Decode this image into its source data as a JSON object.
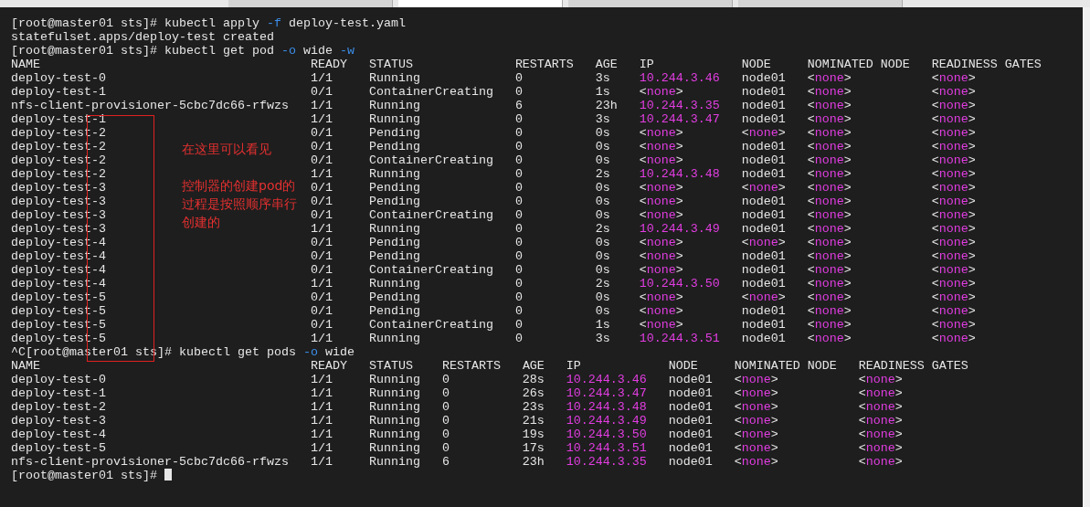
{
  "terminal": {
    "blocks": [
      {
        "kind": "command",
        "parts": [
          {
            "text": "[root@master01 sts]# kubectl apply "
          },
          {
            "text": "-f",
            "kind": "flag"
          },
          {
            "text": " deploy-test.yaml"
          }
        ]
      },
      {
        "kind": "output",
        "text": "statefulset.apps/deploy-test created"
      },
      {
        "kind": "command",
        "parts": [
          {
            "text": "[root@master01 sts]# kubectl get pod "
          },
          {
            "text": "-o",
            "kind": "flag"
          },
          {
            "text": " wide "
          },
          {
            "text": "-w",
            "kind": "flag"
          }
        ]
      },
      {
        "kind": "table",
        "columns": [
          "NAME",
          "READY",
          "STATUS",
          "RESTARTS",
          "AGE",
          "IP",
          "NODE",
          "NOMINATED NODE",
          "READINESS GATES"
        ],
        "rows": [
          [
            "deploy-test-0",
            "1/1",
            "Running",
            "0",
            "3s",
            {
              "kind": "highlight",
              "text": "10.244.3.46"
            },
            "node01",
            {
              "kind": "placeholder",
              "parts": [
                "<",
                "none",
                ">"
              ]
            },
            {
              "kind": "placeholder",
              "parts": [
                "<",
                "none",
                ">"
              ]
            }
          ],
          [
            "deploy-test-1",
            "0/1",
            "ContainerCreating",
            "0",
            "1s",
            {
              "kind": "placeholder",
              "parts": [
                "<",
                "none",
                ">"
              ]
            },
            "node01",
            {
              "kind": "placeholder",
              "parts": [
                "<",
                "none",
                ">"
              ]
            },
            {
              "kind": "placeholder",
              "parts": [
                "<",
                "none",
                ">"
              ]
            }
          ],
          [
            "nfs-client-provisioner-5cbc7dc66-rfwzs",
            "1/1",
            "Running",
            "6",
            "23h",
            {
              "kind": "highlight",
              "text": "10.244.3.35"
            },
            "node01",
            {
              "kind": "placeholder",
              "parts": [
                "<",
                "none",
                ">"
              ]
            },
            {
              "kind": "placeholder",
              "parts": [
                "<",
                "none",
                ">"
              ]
            }
          ],
          [
            "deploy-test-1",
            "1/1",
            "Running",
            "0",
            "3s",
            {
              "kind": "highlight",
              "text": "10.244.3.47"
            },
            "node01",
            {
              "kind": "placeholder",
              "parts": [
                "<",
                "none",
                ">"
              ]
            },
            {
              "kind": "placeholder",
              "parts": [
                "<",
                "none",
                ">"
              ]
            }
          ],
          [
            "deploy-test-2",
            "0/1",
            "Pending",
            "0",
            "0s",
            {
              "kind": "placeholder",
              "parts": [
                "<",
                "none",
                ">"
              ]
            },
            {
              "kind": "placeholder",
              "parts": [
                "<",
                "none",
                ">"
              ]
            },
            {
              "kind": "placeholder",
              "parts": [
                "<",
                "none",
                ">"
              ]
            },
            {
              "kind": "placeholder",
              "parts": [
                "<",
                "none",
                ">"
              ]
            }
          ],
          [
            "deploy-test-2",
            "0/1",
            "Pending",
            "0",
            "0s",
            {
              "kind": "placeholder",
              "parts": [
                "<",
                "none",
                ">"
              ]
            },
            "node01",
            {
              "kind": "placeholder",
              "parts": [
                "<",
                "none",
                ">"
              ]
            },
            {
              "kind": "placeholder",
              "parts": [
                "<",
                "none",
                ">"
              ]
            }
          ],
          [
            "deploy-test-2",
            "0/1",
            "ContainerCreating",
            "0",
            "0s",
            {
              "kind": "placeholder",
              "parts": [
                "<",
                "none",
                ">"
              ]
            },
            "node01",
            {
              "kind": "placeholder",
              "parts": [
                "<",
                "none",
                ">"
              ]
            },
            {
              "kind": "placeholder",
              "parts": [
                "<",
                "none",
                ">"
              ]
            }
          ],
          [
            "deploy-test-2",
            "1/1",
            "Running",
            "0",
            "2s",
            {
              "kind": "highlight",
              "text": "10.244.3.48"
            },
            "node01",
            {
              "kind": "placeholder",
              "parts": [
                "<",
                "none",
                ">"
              ]
            },
            {
              "kind": "placeholder",
              "parts": [
                "<",
                "none",
                ">"
              ]
            }
          ],
          [
            "deploy-test-3",
            "0/1",
            "Pending",
            "0",
            "0s",
            {
              "kind": "placeholder",
              "parts": [
                "<",
                "none",
                ">"
              ]
            },
            {
              "kind": "placeholder",
              "parts": [
                "<",
                "none",
                ">"
              ]
            },
            {
              "kind": "placeholder",
              "parts": [
                "<",
                "none",
                ">"
              ]
            },
            {
              "kind": "placeholder",
              "parts": [
                "<",
                "none",
                ">"
              ]
            }
          ],
          [
            "deploy-test-3",
            "0/1",
            "Pending",
            "0",
            "0s",
            {
              "kind": "placeholder",
              "parts": [
                "<",
                "none",
                ">"
              ]
            },
            "node01",
            {
              "kind": "placeholder",
              "parts": [
                "<",
                "none",
                ">"
              ]
            },
            {
              "kind": "placeholder",
              "parts": [
                "<",
                "none",
                ">"
              ]
            }
          ],
          [
            "deploy-test-3",
            "0/1",
            "ContainerCreating",
            "0",
            "0s",
            {
              "kind": "placeholder",
              "parts": [
                "<",
                "none",
                ">"
              ]
            },
            "node01",
            {
              "kind": "placeholder",
              "parts": [
                "<",
                "none",
                ">"
              ]
            },
            {
              "kind": "placeholder",
              "parts": [
                "<",
                "none",
                ">"
              ]
            }
          ],
          [
            "deploy-test-3",
            "1/1",
            "Running",
            "0",
            "2s",
            {
              "kind": "highlight",
              "text": "10.244.3.49"
            },
            "node01",
            {
              "kind": "placeholder",
              "parts": [
                "<",
                "none",
                ">"
              ]
            },
            {
              "kind": "placeholder",
              "parts": [
                "<",
                "none",
                ">"
              ]
            }
          ],
          [
            "deploy-test-4",
            "0/1",
            "Pending",
            "0",
            "0s",
            {
              "kind": "placeholder",
              "parts": [
                "<",
                "none",
                ">"
              ]
            },
            {
              "kind": "placeholder",
              "parts": [
                "<",
                "none",
                ">"
              ]
            },
            {
              "kind": "placeholder",
              "parts": [
                "<",
                "none",
                ">"
              ]
            },
            {
              "kind": "placeholder",
              "parts": [
                "<",
                "none",
                ">"
              ]
            }
          ],
          [
            "deploy-test-4",
            "0/1",
            "Pending",
            "0",
            "0s",
            {
              "kind": "placeholder",
              "parts": [
                "<",
                "none",
                ">"
              ]
            },
            "node01",
            {
              "kind": "placeholder",
              "parts": [
                "<",
                "none",
                ">"
              ]
            },
            {
              "kind": "placeholder",
              "parts": [
                "<",
                "none",
                ">"
              ]
            }
          ],
          [
            "deploy-test-4",
            "0/1",
            "ContainerCreating",
            "0",
            "0s",
            {
              "kind": "placeholder",
              "parts": [
                "<",
                "none",
                ">"
              ]
            },
            "node01",
            {
              "kind": "placeholder",
              "parts": [
                "<",
                "none",
                ">"
              ]
            },
            {
              "kind": "placeholder",
              "parts": [
                "<",
                "none",
                ">"
              ]
            }
          ],
          [
            "deploy-test-4",
            "1/1",
            "Running",
            "0",
            "2s",
            {
              "kind": "highlight",
              "text": "10.244.3.50"
            },
            "node01",
            {
              "kind": "placeholder",
              "parts": [
                "<",
                "none",
                ">"
              ]
            },
            {
              "kind": "placeholder",
              "parts": [
                "<",
                "none",
                ">"
              ]
            }
          ],
          [
            "deploy-test-5",
            "0/1",
            "Pending",
            "0",
            "0s",
            {
              "kind": "placeholder",
              "parts": [
                "<",
                "none",
                ">"
              ]
            },
            {
              "kind": "placeholder",
              "parts": [
                "<",
                "none",
                ">"
              ]
            },
            {
              "kind": "placeholder",
              "parts": [
                "<",
                "none",
                ">"
              ]
            },
            {
              "kind": "placeholder",
              "parts": [
                "<",
                "none",
                ">"
              ]
            }
          ],
          [
            "deploy-test-5",
            "0/1",
            "Pending",
            "0",
            "0s",
            {
              "kind": "placeholder",
              "parts": [
                "<",
                "none",
                ">"
              ]
            },
            "node01",
            {
              "kind": "placeholder",
              "parts": [
                "<",
                "none",
                ">"
              ]
            },
            {
              "kind": "placeholder",
              "parts": [
                "<",
                "none",
                ">"
              ]
            }
          ],
          [
            "deploy-test-5",
            "0/1",
            "ContainerCreating",
            "0",
            "1s",
            {
              "kind": "placeholder",
              "parts": [
                "<",
                "none",
                ">"
              ]
            },
            "node01",
            {
              "kind": "placeholder",
              "parts": [
                "<",
                "none",
                ">"
              ]
            },
            {
              "kind": "placeholder",
              "parts": [
                "<",
                "none",
                ">"
              ]
            }
          ],
          [
            "deploy-test-5",
            "1/1",
            "Running",
            "0",
            "3s",
            {
              "kind": "highlight",
              "text": "10.244.3.51"
            },
            "node01",
            {
              "kind": "placeholder",
              "parts": [
                "<",
                "none",
                ">"
              ]
            },
            {
              "kind": "placeholder",
              "parts": [
                "<",
                "none",
                ">"
              ]
            }
          ]
        ]
      },
      {
        "kind": "command",
        "parts": [
          {
            "text": "^C[root@master01 sts]# kubectl get pods "
          },
          {
            "text": "-o",
            "kind": "flag"
          },
          {
            "text": " wide"
          }
        ]
      },
      {
        "kind": "table",
        "columns": [
          "NAME",
          "READY",
          "STATUS",
          "RESTARTS",
          "AGE",
          "IP",
          "NODE",
          "NOMINATED NODE",
          "READINESS GATES"
        ],
        "rows": [
          [
            "deploy-test-0",
            "1/1",
            "Running",
            "0",
            "28s",
            {
              "kind": "highlight",
              "text": "10.244.3.46"
            },
            "node01",
            {
              "kind": "placeholder",
              "parts": [
                "<",
                "none",
                ">"
              ]
            },
            {
              "kind": "placeholder",
              "parts": [
                "<",
                "none",
                ">"
              ]
            }
          ],
          [
            "deploy-test-1",
            "1/1",
            "Running",
            "0",
            "26s",
            {
              "kind": "highlight",
              "text": "10.244.3.47"
            },
            "node01",
            {
              "kind": "placeholder",
              "parts": [
                "<",
                "none",
                ">"
              ]
            },
            {
              "kind": "placeholder",
              "parts": [
                "<",
                "none",
                ">"
              ]
            }
          ],
          [
            "deploy-test-2",
            "1/1",
            "Running",
            "0",
            "23s",
            {
              "kind": "highlight",
              "text": "10.244.3.48"
            },
            "node01",
            {
              "kind": "placeholder",
              "parts": [
                "<",
                "none",
                ">"
              ]
            },
            {
              "kind": "placeholder",
              "parts": [
                "<",
                "none",
                ">"
              ]
            }
          ],
          [
            "deploy-test-3",
            "1/1",
            "Running",
            "0",
            "21s",
            {
              "kind": "highlight",
              "text": "10.244.3.49"
            },
            "node01",
            {
              "kind": "placeholder",
              "parts": [
                "<",
                "none",
                ">"
              ]
            },
            {
              "kind": "placeholder",
              "parts": [
                "<",
                "none",
                ">"
              ]
            }
          ],
          [
            "deploy-test-4",
            "1/1",
            "Running",
            "0",
            "19s",
            {
              "kind": "highlight",
              "text": "10.244.3.50"
            },
            "node01",
            {
              "kind": "placeholder",
              "parts": [
                "<",
                "none",
                ">"
              ]
            },
            {
              "kind": "placeholder",
              "parts": [
                "<",
                "none",
                ">"
              ]
            }
          ],
          [
            "deploy-test-5",
            "1/1",
            "Running",
            "0",
            "17s",
            {
              "kind": "highlight",
              "text": "10.244.3.51"
            },
            "node01",
            {
              "kind": "placeholder",
              "parts": [
                "<",
                "none",
                ">"
              ]
            },
            {
              "kind": "placeholder",
              "parts": [
                "<",
                "none",
                ">"
              ]
            }
          ],
          [
            "nfs-client-provisioner-5cbc7dc66-rfwzs",
            "1/1",
            "Running",
            "6",
            "23h",
            {
              "kind": "highlight",
              "text": "10.244.3.35"
            },
            "node01",
            {
              "kind": "placeholder",
              "parts": [
                "<",
                "none",
                ">"
              ]
            },
            {
              "kind": "placeholder",
              "parts": [
                "<",
                "none",
                ">"
              ]
            }
          ]
        ]
      },
      {
        "kind": "command",
        "cursor": true,
        "parts": [
          {
            "text": "[root@master01 sts]# "
          }
        ]
      }
    ]
  },
  "annotation": {
    "heading": "在这里可以看见",
    "lines": [
      "控制器的创建pod的",
      "过程是按照顺序串行",
      "创建的"
    ]
  }
}
